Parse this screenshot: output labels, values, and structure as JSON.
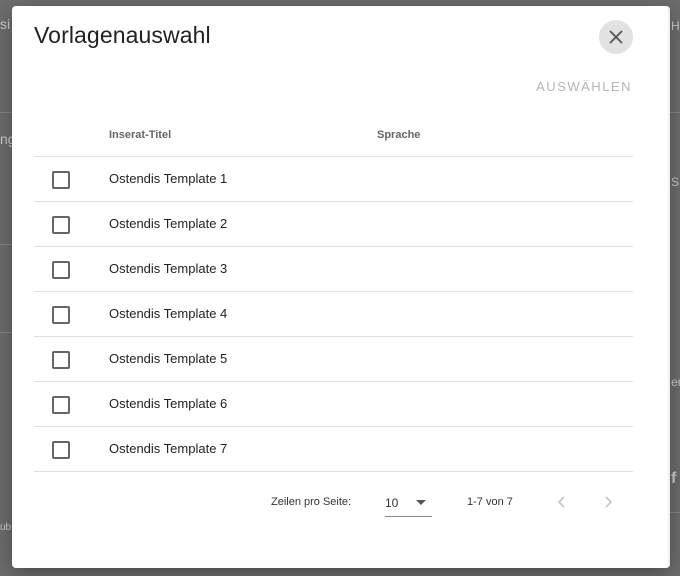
{
  "background": {
    "edge_left": [
      "si",
      "ng",
      "ub"
    ],
    "edge_right": [
      "H",
      "S",
      "er",
      "f"
    ]
  },
  "dialog": {
    "title": "Vorlagenauswahl",
    "select_label": "AUSWÄHLEN",
    "close_icon": "close-icon"
  },
  "table": {
    "headers": {
      "title": "Inserat-Titel",
      "language": "Sprache"
    },
    "rows": [
      {
        "title": "Ostendis Template 1",
        "language": ""
      },
      {
        "title": "Ostendis Template 2",
        "language": ""
      },
      {
        "title": "Ostendis Template 3",
        "language": ""
      },
      {
        "title": "Ostendis Template 4",
        "language": ""
      },
      {
        "title": "Ostendis Template 5",
        "language": ""
      },
      {
        "title": "Ostendis Template 6",
        "language": ""
      },
      {
        "title": "Ostendis Template 7",
        "language": ""
      }
    ]
  },
  "pagination": {
    "rows_per_page_label": "Zeilen pro Seite:",
    "rows_per_page_value": "10",
    "range": "1-7 von 7"
  },
  "colors": {
    "accent": "#616161",
    "overlay": "#6e6e6e"
  }
}
